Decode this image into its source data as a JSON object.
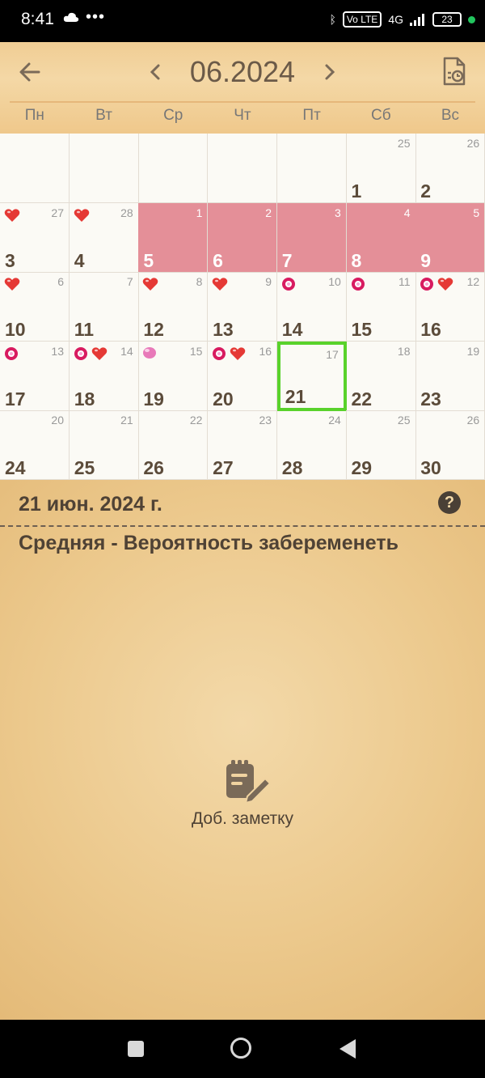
{
  "status": {
    "time": "8:41",
    "dots": "•••",
    "battery": "23",
    "volte": "Vo LTE",
    "network": "4G"
  },
  "header": {
    "month": "06.2024",
    "weekdays": [
      "Пн",
      "Вт",
      "Ср",
      "Чт",
      "Пт",
      "Сб",
      "Вс"
    ]
  },
  "calendar": {
    "rows": [
      [
        {
          "day": "",
          "cycle": "",
          "pink": false,
          "icons": []
        },
        {
          "day": "",
          "cycle": "",
          "pink": false,
          "icons": []
        },
        {
          "day": "",
          "cycle": "",
          "pink": false,
          "icons": []
        },
        {
          "day": "",
          "cycle": "",
          "pink": false,
          "icons": []
        },
        {
          "day": "",
          "cycle": "",
          "pink": false,
          "icons": []
        },
        {
          "day": "1",
          "cycle": "25",
          "pink": false,
          "icons": []
        },
        {
          "day": "2",
          "cycle": "26",
          "pink": false,
          "icons": []
        }
      ],
      [
        {
          "day": "3",
          "cycle": "27",
          "pink": false,
          "icons": [
            "heart"
          ]
        },
        {
          "day": "4",
          "cycle": "28",
          "pink": false,
          "icons": [
            "heart"
          ]
        },
        {
          "day": "5",
          "cycle": "1",
          "pink": true,
          "icons": []
        },
        {
          "day": "6",
          "cycle": "2",
          "pink": true,
          "icons": []
        },
        {
          "day": "7",
          "cycle": "3",
          "pink": true,
          "icons": []
        },
        {
          "day": "8",
          "cycle": "4",
          "pink": true,
          "icons": []
        },
        {
          "day": "9",
          "cycle": "5",
          "pink": true,
          "icons": []
        }
      ],
      [
        {
          "day": "10",
          "cycle": "6",
          "pink": false,
          "icons": [
            "heart"
          ]
        },
        {
          "day": "11",
          "cycle": "7",
          "pink": false,
          "icons": []
        },
        {
          "day": "12",
          "cycle": "8",
          "pink": false,
          "icons": [
            "heart"
          ]
        },
        {
          "day": "13",
          "cycle": "9",
          "pink": false,
          "icons": [
            "heart"
          ]
        },
        {
          "day": "14",
          "cycle": "10",
          "pink": false,
          "icons": [
            "flower"
          ]
        },
        {
          "day": "15",
          "cycle": "11",
          "pink": false,
          "icons": [
            "flower"
          ]
        },
        {
          "day": "16",
          "cycle": "12",
          "pink": false,
          "icons": [
            "flower",
            "heart"
          ]
        }
      ],
      [
        {
          "day": "17",
          "cycle": "13",
          "pink": false,
          "icons": [
            "flower"
          ]
        },
        {
          "day": "18",
          "cycle": "14",
          "pink": false,
          "icons": [
            "flower",
            "heart"
          ]
        },
        {
          "day": "19",
          "cycle": "15",
          "pink": false,
          "icons": [
            "egg"
          ]
        },
        {
          "day": "20",
          "cycle": "16",
          "pink": false,
          "icons": [
            "flower",
            "heart"
          ]
        },
        {
          "day": "21",
          "cycle": "17",
          "pink": false,
          "icons": [],
          "selected": true
        },
        {
          "day": "22",
          "cycle": "18",
          "pink": false,
          "icons": []
        },
        {
          "day": "23",
          "cycle": "19",
          "pink": false,
          "icons": []
        }
      ],
      [
        {
          "day": "24",
          "cycle": "20",
          "pink": false,
          "icons": []
        },
        {
          "day": "25",
          "cycle": "21",
          "pink": false,
          "icons": []
        },
        {
          "day": "26",
          "cycle": "22",
          "pink": false,
          "icons": []
        },
        {
          "day": "27",
          "cycle": "23",
          "pink": false,
          "icons": []
        },
        {
          "day": "28",
          "cycle": "24",
          "pink": false,
          "icons": []
        },
        {
          "day": "29",
          "cycle": "25",
          "pink": false,
          "icons": []
        },
        {
          "day": "30",
          "cycle": "26",
          "pink": false,
          "icons": []
        }
      ]
    ]
  },
  "detail": {
    "date": "21 июн. 2024 г.",
    "help": "?",
    "chance": "Средняя - Вероятность забеременеть",
    "add_note": "Доб. заметку"
  },
  "colors": {
    "period": "#e48f98",
    "selected_border": "#59d22b",
    "heart": "#e53935",
    "flower": "#d81b60"
  }
}
